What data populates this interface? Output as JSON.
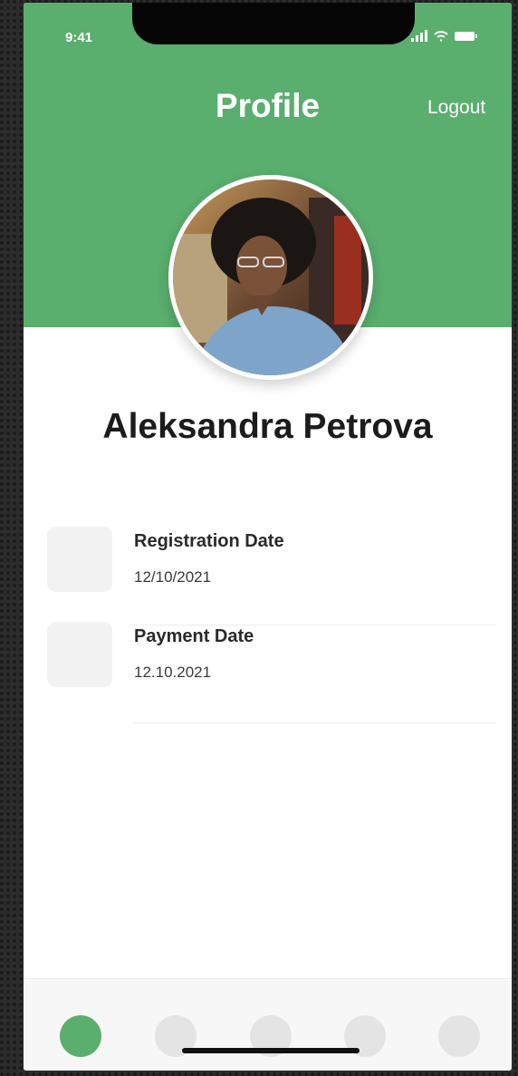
{
  "status_bar": {
    "time": "9:41"
  },
  "header": {
    "title": "Profile",
    "logout_label": "Logout",
    "background_color": "#5aae6e"
  },
  "user": {
    "name": "Aleksandra Petrova",
    "avatar": "profile-photo"
  },
  "info_items": [
    {
      "label": "Registration Date",
      "value": "12/10/2021",
      "icon": "placeholder-icon"
    },
    {
      "label": "Payment Date",
      "value": "12.10.2021",
      "icon": "placeholder-icon"
    }
  ],
  "tab_bar": {
    "tabs": [
      {
        "name": "tab-1",
        "active": true
      },
      {
        "name": "tab-2",
        "active": false
      },
      {
        "name": "tab-3",
        "active": false
      },
      {
        "name": "tab-4",
        "active": false
      },
      {
        "name": "tab-5",
        "active": false
      }
    ],
    "active_color": "#5aae6e",
    "inactive_color": "#e4e4e4"
  }
}
